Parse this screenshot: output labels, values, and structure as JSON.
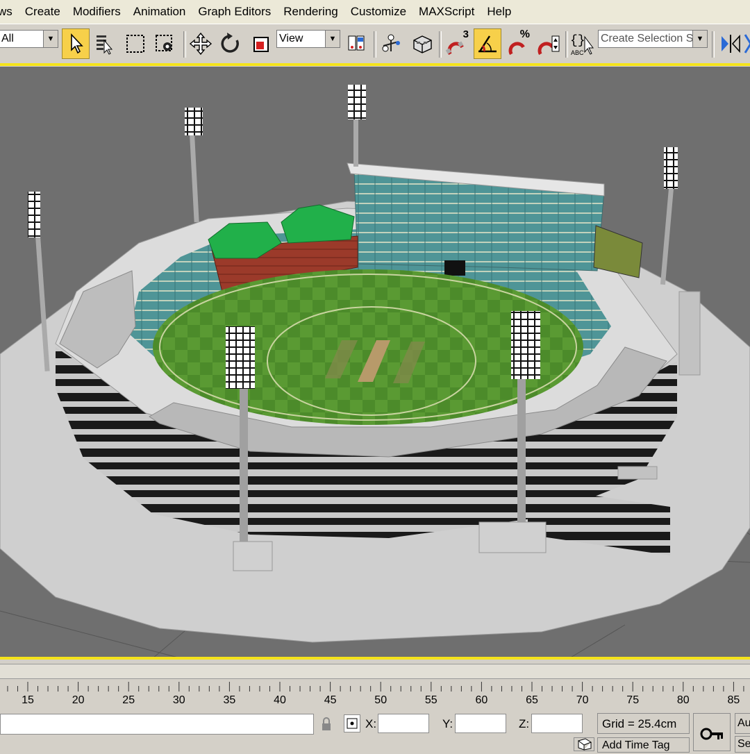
{
  "menu": {
    "items": [
      "ws",
      "Create",
      "Modifiers",
      "Animation",
      "Graph Editors",
      "Rendering",
      "Customize",
      "MAXScript",
      "Help"
    ]
  },
  "toolbar": {
    "selection_filter": "All",
    "reference_coord": "View",
    "named_selection_placeholder": "Create Selection Set",
    "snap_angle_label": "3",
    "percent_snap_label": "%",
    "tools": [
      "select-object-icon",
      "select-by-name-icon",
      "rectangular-selection-icon",
      "window-crossing-icon",
      "move-icon",
      "rotate-icon",
      "scale-icon",
      "pivot-icon",
      "manipulate-icon",
      "keyboard-shortcut-icon",
      "snap-3d-icon",
      "angle-snap-icon",
      "percent-snap-icon",
      "spinner-snap-icon",
      "edit-named-selections-icon",
      "mirror-icon"
    ]
  },
  "timeline": {
    "ticks": [
      "15",
      "20",
      "25",
      "30",
      "35",
      "40",
      "45",
      "50",
      "55",
      "60",
      "65",
      "70",
      "75",
      "80",
      "85"
    ]
  },
  "status": {
    "x_label": "X:",
    "y_label": "Y:",
    "z_label": "Z:",
    "x_value": "",
    "y_value": "",
    "z_value": "",
    "grid": "Grid = 25.4cm",
    "add_time_tag": "Add Time Tag",
    "auto_key_fragment": "Au",
    "set_key_fragment": "Se"
  },
  "colors": {
    "viewport_bg": "#6f6f6f",
    "active_yellow": "#f5e31b",
    "field_green": "#4a8a2a",
    "stand_teal": "#4e8f93",
    "roof_green": "#21b04a",
    "brick_red": "#9b3a2a"
  }
}
